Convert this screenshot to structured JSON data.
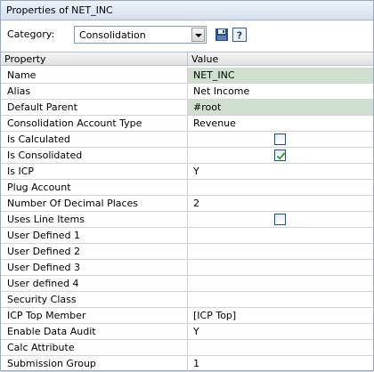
{
  "title": "Properties of NET_INC",
  "category": {
    "label": "Category:",
    "value": "Consolidation"
  },
  "columns": {
    "property": "Property",
    "value": "Value"
  },
  "rows": [
    {
      "name": "Name",
      "value": "NET_INC",
      "highlight": true
    },
    {
      "name": "Alias",
      "value": "Net Income"
    },
    {
      "name": "Default Parent",
      "value": "#root",
      "highlight": true
    },
    {
      "name": "Consolidation Account Type",
      "value": "Revenue"
    },
    {
      "name": "Is Calculated",
      "checkbox": true,
      "checked": false
    },
    {
      "name": "Is Consolidated",
      "checkbox": true,
      "checked": true
    },
    {
      "name": "Is ICP",
      "value": "Y"
    },
    {
      "name": "Plug Account",
      "value": ""
    },
    {
      "name": "Number Of Decimal Places",
      "value": "2"
    },
    {
      "name": "Uses Line Items",
      "checkbox": true,
      "checked": false
    },
    {
      "name": "User Defined 1",
      "value": ""
    },
    {
      "name": "User Defined 2",
      "value": ""
    },
    {
      "name": "User Defined 3",
      "value": ""
    },
    {
      "name": "User defined 4",
      "value": ""
    },
    {
      "name": "Security Class",
      "value": ""
    },
    {
      "name": "ICP Top Member",
      "value": "[ICP Top]"
    },
    {
      "name": "Enable Data Audit",
      "value": "Y"
    },
    {
      "name": "Calc Attribute",
      "value": ""
    },
    {
      "name": "Submission Group",
      "value": "1"
    }
  ],
  "icons": {
    "save": "save-icon",
    "help": "help-icon"
  },
  "colors": {
    "title_bar": "#d6e0ee",
    "highlight": "#cfe0cf",
    "checkbox_border": "#1c5180"
  }
}
